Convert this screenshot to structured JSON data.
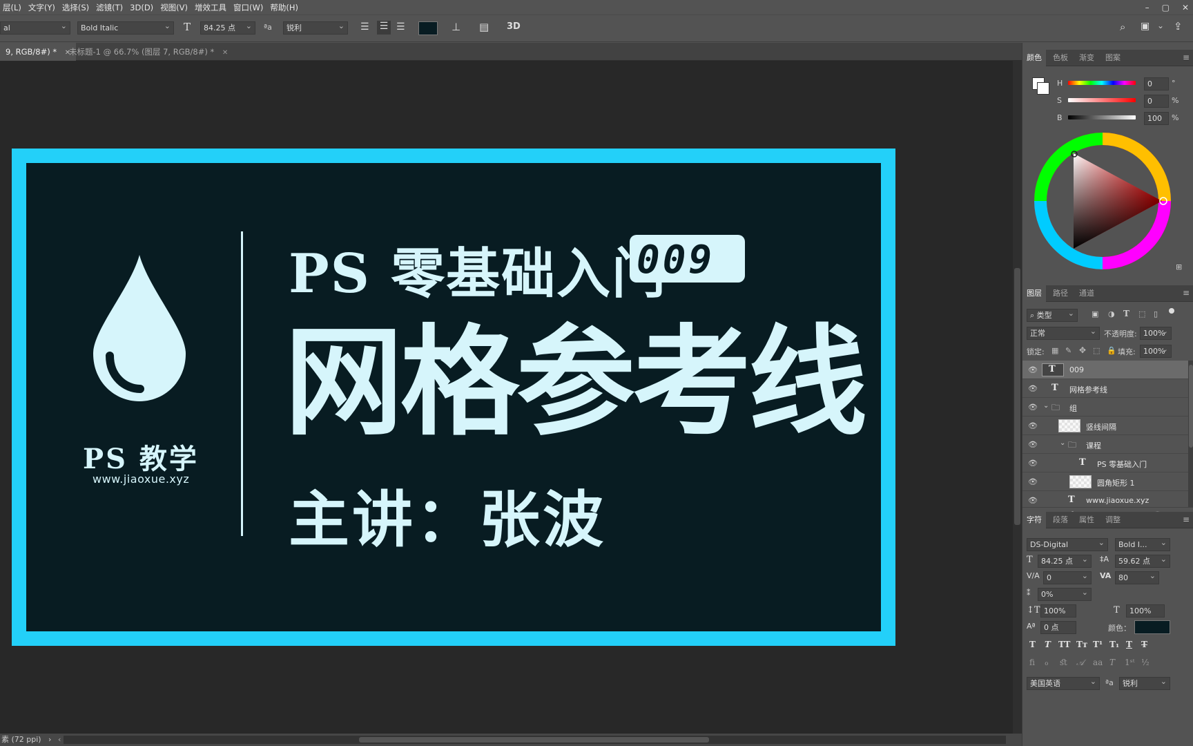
{
  "menu": [
    "层(L)",
    "文字(Y)",
    "选择(S)",
    "滤镜(T)",
    "3D(D)",
    "视图(V)",
    "增效工具",
    "窗口(W)",
    "帮助(H)"
  ],
  "window_controls": [
    "–",
    "▢",
    "✕"
  ],
  "options_bar": {
    "font_style_left": "al",
    "font_style": "Bold Italic",
    "font_size": "84.25 点",
    "anti_alias_label": "ªa",
    "anti_alias": "锐利",
    "threed_label": "3D"
  },
  "tabs": [
    {
      "label": "9, RGB/8#) *",
      "close": "✕"
    },
    {
      "label": "未标题-1 @ 66.7% (图层 7, RGB/8#) *",
      "close": "✕"
    }
  ],
  "canvas": {
    "colors": {
      "border": "#23d0f9",
      "background": "#081c22",
      "text": "#d6f5fb"
    },
    "logo_title": "PS 教学",
    "logo_url": "www.jiaoxue.xyz",
    "headline": "PS 零基础入门",
    "badge": "009",
    "main_title": "网格参考线",
    "presenter": "主讲：张波"
  },
  "status_bar": {
    "text": "素 (72 ppi)",
    "arrow": "›",
    "left_arrow": "‹",
    "right_arrow": "›"
  },
  "color_panel": {
    "tabs": [
      "颜色",
      "色板",
      "渐变",
      "图案"
    ],
    "h_label": "H",
    "h_value": "0",
    "h_unit": "°",
    "s_label": "S",
    "s_value": "0",
    "s_unit": "%",
    "b_label": "B",
    "b_value": "100",
    "b_unit": "%"
  },
  "layers_panel": {
    "tabs": [
      "图层",
      "路径",
      "通道"
    ],
    "filter_label": "类型",
    "blend_mode": "正常",
    "opacity_label": "不透明度:",
    "opacity": "100%",
    "lock_label": "锁定:",
    "fill_label": "填充:",
    "fill": "100%",
    "layers": [
      {
        "name": "009",
        "type": "text",
        "indent": 0,
        "selected": true
      },
      {
        "name": "网格参考线",
        "type": "text",
        "indent": 0,
        "selected": false
      },
      {
        "name": "组",
        "type": "group",
        "indent": 0,
        "selected": false
      },
      {
        "name": "竖线间隔",
        "type": "shape",
        "indent": 1,
        "selected": false
      },
      {
        "name": "课程",
        "type": "group",
        "indent": 1,
        "selected": false
      },
      {
        "name": "PS 零基础入门",
        "type": "text",
        "indent": 2,
        "selected": false
      },
      {
        "name": "圆角矩形 1",
        "type": "shape",
        "indent": 2,
        "selected": false
      },
      {
        "name": "www.jiaoxue.xyz",
        "type": "text",
        "indent": 1,
        "selected": false
      }
    ],
    "bottom_icons": [
      "link-icon",
      "fx-icon",
      "mask-icon",
      "adjustment-icon",
      "folder-icon",
      "new-layer-icon",
      "trash-icon"
    ]
  },
  "character_panel": {
    "tabs": [
      "字符",
      "段落",
      "属性",
      "调整"
    ],
    "font_family": "DS-Digital",
    "font_style": "Bold I...",
    "size": "84.25 点",
    "leading": "59.62 点",
    "kerning": "0",
    "tracking": "80",
    "scale_pct": "0%",
    "vertical_scale": "100%",
    "horizontal_scale": "100%",
    "baseline": "0 点",
    "color_label": "颜色：",
    "language": "美国英语",
    "aa_label": "ªa",
    "anti_alias": "锐利"
  }
}
